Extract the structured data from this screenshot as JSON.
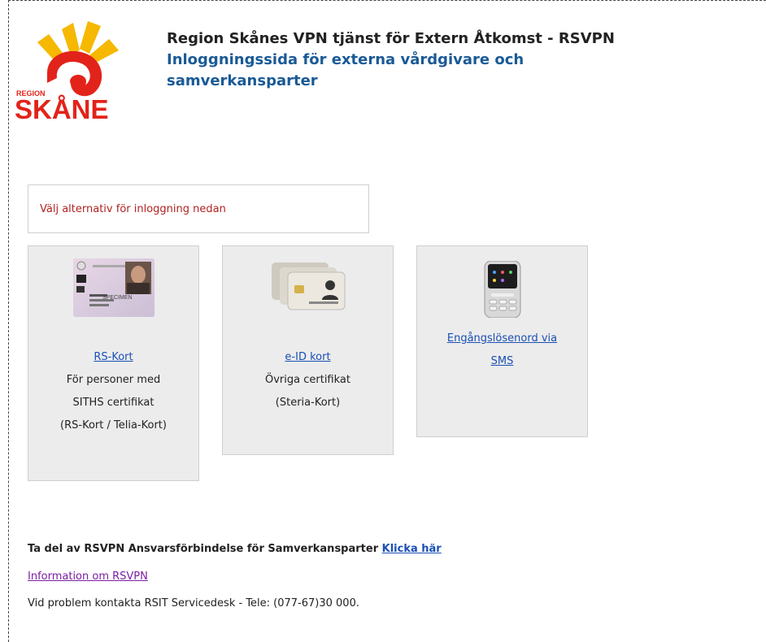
{
  "brand": {
    "logo_region": "REGION",
    "logo_name": "SKÅNE",
    "colors": {
      "red": "#e2231a",
      "yellow": "#f6b800",
      "blue_heading": "#1a5a96",
      "link": "#1a4fb5",
      "visited": "#7a1fa2",
      "prompt": "#b22222"
    }
  },
  "header": {
    "title": "Region Skånes VPN tjänst för Extern Åtkomst - RSVPN",
    "subtitle": "Inloggningssida för externa vårdgivare och samverkansparter"
  },
  "prompt": "Välj alternativ för inloggning nedan",
  "cards": [
    {
      "icon": "id-card-icon",
      "link": "RS-Kort",
      "desc": [
        "För personer med",
        "SITHS certifikat",
        "(RS-Kort / Telia-Kort)"
      ],
      "card_text_big": "SPECIMEN"
    },
    {
      "icon": "smart-cards-icon",
      "link": "e-ID kort",
      "desc": [
        "Övriga certifikat",
        "(Steria-Kort)"
      ]
    },
    {
      "icon": "mobile-phone-icon",
      "link_lines": [
        "Engångslösenord via",
        "SMS"
      ]
    }
  ],
  "footer": {
    "agreement_text": "Ta del av RSVPN Ansvarsförbindelse för Samverkansparter",
    "agreement_link": "Klicka här",
    "info_link": "Information om RSVPN",
    "support": "Vid problem kontakta RSIT Servicedesk - Tele: (077-67)30 000."
  }
}
